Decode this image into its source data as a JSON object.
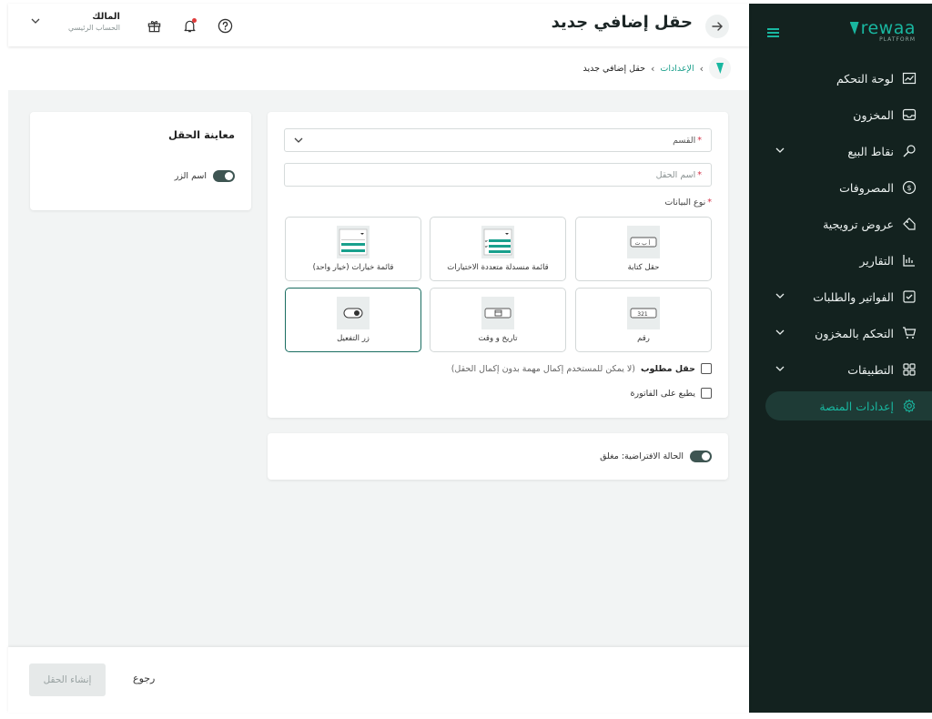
{
  "colors": {
    "accent": "#19b7a0",
    "sidebar_bg": "#13221f",
    "selected_border": "#1a6d61",
    "required": "#d6334a"
  },
  "brand": {
    "name": "rewaa",
    "tagline": "PLATFORM"
  },
  "sidebar": {
    "items": [
      {
        "label": "لوحة التحكم",
        "icon": "chart-line-icon",
        "has_children": false,
        "active": false
      },
      {
        "label": "المخزون",
        "icon": "inbox-icon",
        "has_children": false,
        "active": false
      },
      {
        "label": "نقاط البيع",
        "icon": "search-tag-icon",
        "has_children": true,
        "active": false
      },
      {
        "label": "المصروفات",
        "icon": "dollar-circle-icon",
        "has_children": false,
        "active": false
      },
      {
        "label": "عروض ترويجية",
        "icon": "tag-icon",
        "has_children": false,
        "active": false
      },
      {
        "label": "التقارير",
        "icon": "bar-chart-icon",
        "has_children": false,
        "active": false
      },
      {
        "label": "الفواتير والطلبات",
        "icon": "checkbox-icon",
        "has_children": true,
        "active": false
      },
      {
        "label": "التحكم بالمخزون",
        "icon": "cart-icon",
        "has_children": true,
        "active": false
      },
      {
        "label": "التطبيقات",
        "icon": "grid-icon",
        "has_children": true,
        "active": false
      },
      {
        "label": "إعدادات المنصة",
        "icon": "gear-icon",
        "has_children": false,
        "active": true
      }
    ]
  },
  "header": {
    "title": "حقل إضافي جديد",
    "user_name": "المالك",
    "user_role": "الحساب الرئيسي"
  },
  "breadcrumb": {
    "parent": "الإعدادات",
    "current": "حقل إضافي جديد"
  },
  "form": {
    "section_placeholder": "القسم",
    "field_name_placeholder": "اسم الحقل",
    "data_type_label": "نوع البيانات",
    "data_types": [
      {
        "label": "حقل كتابة",
        "icon": "text-field-icon",
        "selected": false
      },
      {
        "label": "قائمة منسدلة متعددة الاختيارات",
        "icon": "multi-dropdown-icon",
        "selected": false
      },
      {
        "label": "قائمة خيارات  (خيار واحد)",
        "icon": "single-dropdown-icon",
        "selected": false
      },
      {
        "label": "رقم",
        "icon": "number-field-icon",
        "selected": false
      },
      {
        "label": "تاريخ و وقت",
        "icon": "calendar-icon",
        "selected": false
      },
      {
        "label": "زر التفعيل",
        "icon": "toggle-icon",
        "selected": true
      }
    ],
    "required_label": "حقل مطلوب",
    "required_hint": "(لا يمكن للمستخدم إكمال مهمة بدون إكمال الحقل)",
    "print_label": "يطبع على الفاتورة"
  },
  "preview": {
    "title": "معاينة الحقل",
    "toggle_label": "اسم الزر"
  },
  "default_state": {
    "label": "الحالة الافتراضية: مغلق"
  },
  "footer": {
    "create_label": "إنشاء الحقل",
    "back_label": "رجوع"
  }
}
